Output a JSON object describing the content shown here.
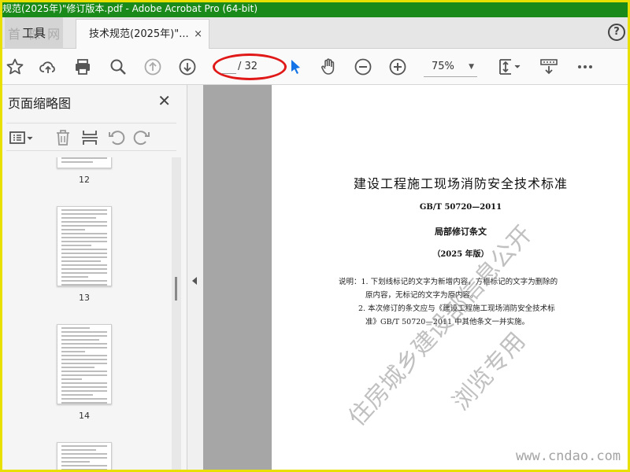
{
  "window": {
    "title": "规范(2025年)\"修订版本.pdf - Adobe Acrobat Pro (64-bit)"
  },
  "tabs": {
    "tools_label": "工具",
    "doc_label": "技术规范(2025年)\"...",
    "close_glyph": "×",
    "help_glyph": "?"
  },
  "watermark_top": "首 株 网",
  "toolbar": {
    "page_total": "/ 32",
    "zoom": "75%",
    "icons": [
      "bookmark-star-icon",
      "upload-cloud-icon",
      "print-icon",
      "search-zoom-icon",
      "page-up-icon",
      "page-down-icon",
      "select-cursor-icon",
      "hand-icon",
      "zoom-out-icon",
      "zoom-in-icon",
      "fit-page-icon",
      "read-mode-icon",
      "more-icon"
    ]
  },
  "sidepanel": {
    "title": "页面缩略图",
    "close_glyph": "✕",
    "thumbnails": [
      {
        "label": "12"
      },
      {
        "label": "13"
      },
      {
        "label": "14"
      }
    ]
  },
  "document": {
    "title": "建设工程施工现场消防安全技术标准",
    "code": "GB/T 50720—2011",
    "subtitle": "局部修订条文",
    "year": "（2025 年版）",
    "notes": [
      "说明：1. 下划线标记的文字为新增内容，方框标记的文字为删除的",
      "原内容，无标记的文字为原内容。",
      "2. 本次修订的条文应与《建设工程施工现场消防安全技术标",
      "准》GB/T 50720—2011 中其他条文一并实施。"
    ]
  },
  "watermarks": {
    "line1": "住房城乡建设部信息公开",
    "line2": "浏览专用",
    "site": "www.cndao.com"
  },
  "colors": {
    "titlebar": "#1a8a1a",
    "frame": "#e8e000",
    "annotation": "#e01818",
    "cursor_accent": "#1473e6"
  }
}
